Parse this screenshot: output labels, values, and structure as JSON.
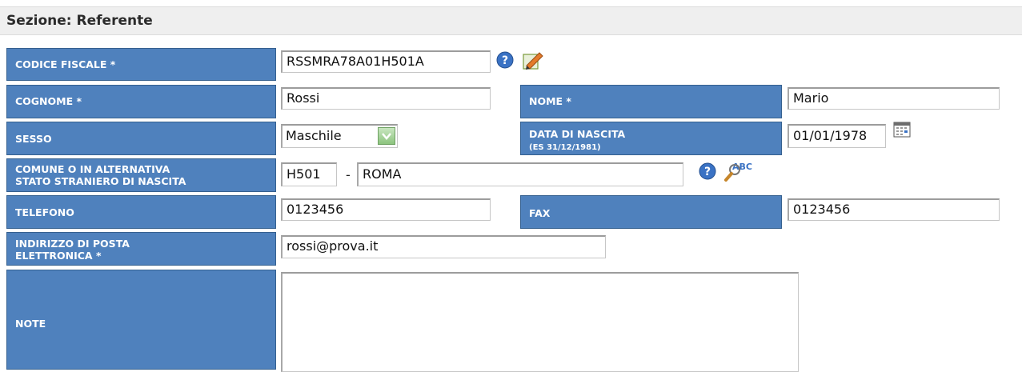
{
  "section": {
    "title": "Sezione: Referente"
  },
  "labels": {
    "codice_fiscale": "CODICE FISCALE *",
    "cognome": "COGNOME *",
    "nome": "NOME *",
    "sesso": "SESSO",
    "data_nascita": "DATA DI NASCITA",
    "data_nascita_hint": "(ES 31/12/1981)",
    "comune_line1": "COMUNE O IN ALTERNATIVA",
    "comune_line2": "STATO STRANIERO DI NASCITA",
    "telefono": "TELEFONO",
    "fax": "FAX",
    "email_line1": "INDIRIZZO DI POSTA",
    "email_line2": "ELETTRONICA *",
    "note": "NOTE"
  },
  "values": {
    "codice_fiscale": "RSSMRA78A01H501A",
    "cognome": "Rossi",
    "nome": "Mario",
    "sesso": "Maschile",
    "data_nascita": "01/01/1978",
    "comune_codice": "H501",
    "comune_separator": "-",
    "comune_nome": "ROMA",
    "telefono": "0123456",
    "fax": "0123456",
    "email": "rossi@prova.it",
    "note": ""
  },
  "icons": {
    "cf_help": "help-icon",
    "cf_edit": "edit-icon",
    "calendar": "calendar-icon",
    "comune_help": "help-icon",
    "comune_search": "spellcheck-search-icon"
  },
  "colors": {
    "label_bg": "#4f81bd",
    "header_bg": "#efefef",
    "help_icon": "#3a72c4"
  }
}
